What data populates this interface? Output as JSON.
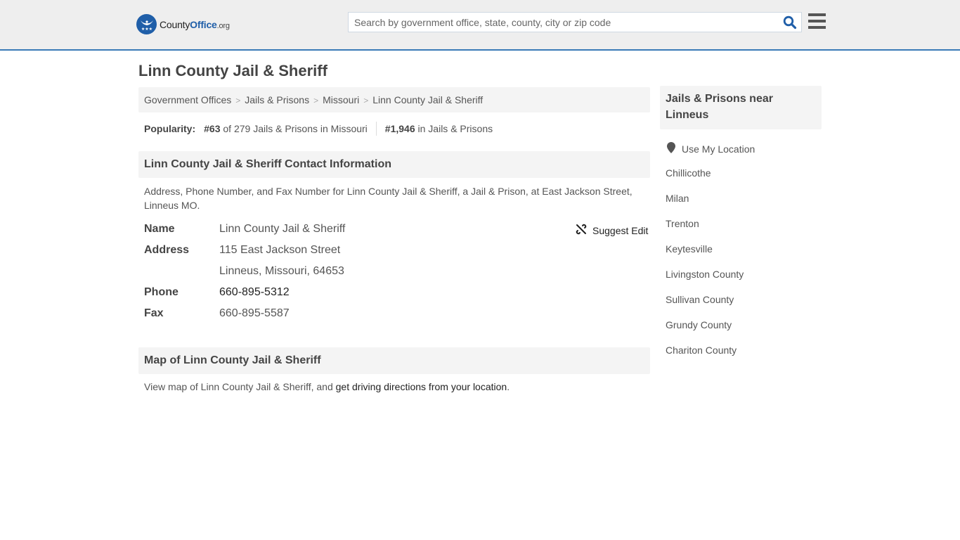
{
  "header": {
    "logo": {
      "part1": "County",
      "part2": "Office",
      "part3": ".org"
    },
    "search": {
      "placeholder": "Search by government office, state, county, city or zip code",
      "value": ""
    },
    "search_icon": "search-icon",
    "menu_icon": "hamburger-menu-icon",
    "accent_color": "#3a7ab7"
  },
  "page": {
    "title": "Linn County Jail & Sheriff",
    "breadcrumb": [
      {
        "label": "Government Offices"
      },
      {
        "label": "Jails & Prisons"
      },
      {
        "label": "Missouri"
      },
      {
        "label": "Linn County Jail & Sheriff"
      }
    ],
    "popularity": {
      "label": "Popularity:",
      "state_rank": "#63",
      "state_text": "of 279 Jails & Prisons in Missouri",
      "national_rank": "#1,946",
      "national_text": "in Jails & Prisons"
    }
  },
  "contact": {
    "heading": "Linn County Jail & Sheriff Contact Information",
    "description": "Address, Phone Number, and Fax Number for Linn County Jail & Sheriff, a Jail & Prison, at East Jackson Street, Linneus MO.",
    "suggest_edit": "Suggest Edit",
    "fields": {
      "name_label": "Name",
      "name": "Linn County Jail & Sheriff",
      "address_label": "Address",
      "address_line1": "115 East Jackson Street",
      "address_line2": "Linneus, Missouri, 64653",
      "phone_label": "Phone",
      "phone": "660-895-5312",
      "fax_label": "Fax",
      "fax": "660-895-5587"
    }
  },
  "map": {
    "heading": "Map of Linn County Jail & Sheriff",
    "text_prefix": "View map of Linn County Jail & Sheriff, and ",
    "link": "get driving directions from your location",
    "text_suffix": "."
  },
  "sidebar": {
    "heading": "Jails & Prisons near Linneus",
    "use_location": "Use My Location",
    "items": [
      {
        "label": "Chillicothe"
      },
      {
        "label": "Milan"
      },
      {
        "label": "Trenton"
      },
      {
        "label": "Keytesville"
      },
      {
        "label": "Livingston County"
      },
      {
        "label": "Sullivan County"
      },
      {
        "label": "Grundy County"
      },
      {
        "label": "Chariton County"
      }
    ]
  }
}
